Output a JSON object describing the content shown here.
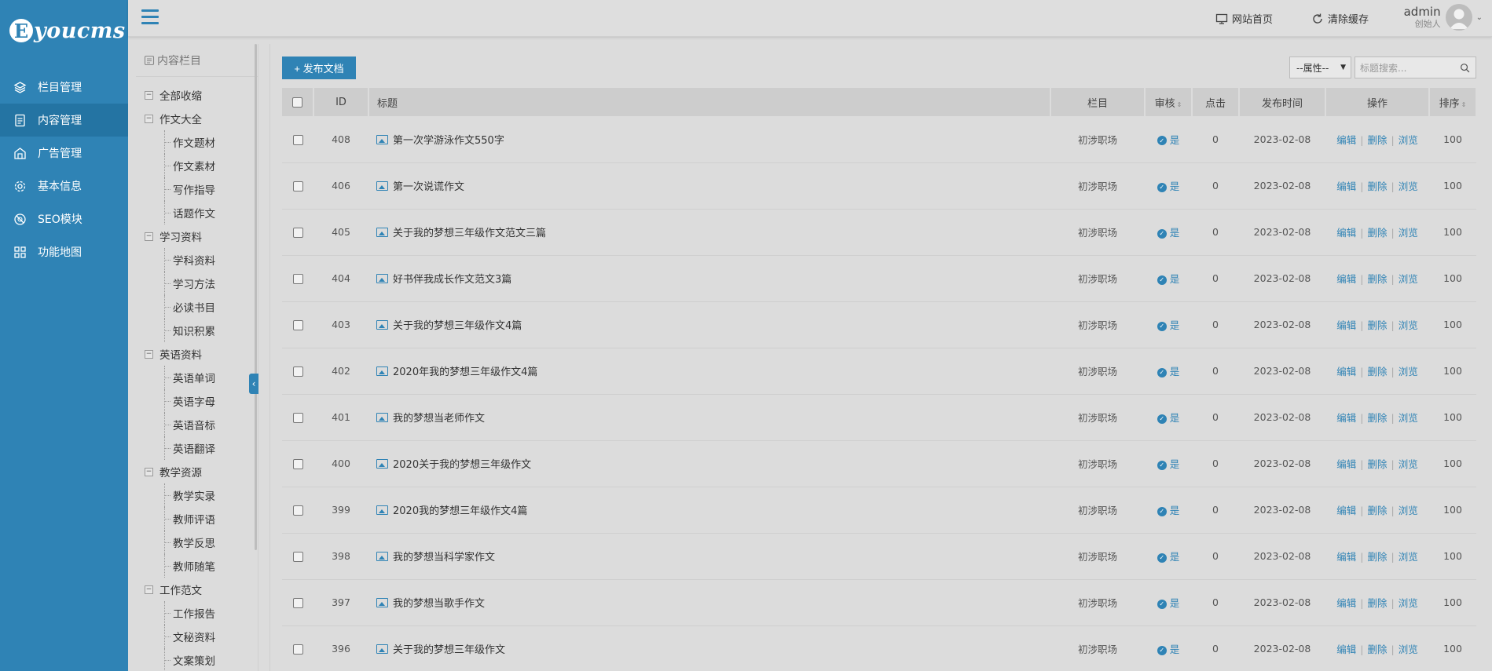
{
  "logo": {
    "mark": "E",
    "text": "youcms"
  },
  "sidebar": {
    "items": [
      {
        "label": "栏目管理",
        "icon": "layers-icon",
        "active": false
      },
      {
        "label": "内容管理",
        "icon": "document-icon",
        "active": true
      },
      {
        "label": "广告管理",
        "icon": "ad-icon",
        "active": false
      },
      {
        "label": "基本信息",
        "icon": "gear-icon",
        "active": false
      },
      {
        "label": "SEO模块",
        "icon": "seo-icon",
        "active": false
      },
      {
        "label": "功能地图",
        "icon": "grid-icon",
        "active": false
      }
    ]
  },
  "header": {
    "home_label": "网站首页",
    "clear_cache_label": "清除缓存",
    "user_name": "admin",
    "user_role": "创始人"
  },
  "tree": {
    "title": "内容栏目",
    "nodes": [
      {
        "label": "全部收缩",
        "level": 0
      },
      {
        "label": "作文大全",
        "level": 0
      },
      {
        "label": "作文题材",
        "level": 1
      },
      {
        "label": "作文素材",
        "level": 1
      },
      {
        "label": "写作指导",
        "level": 1
      },
      {
        "label": "话题作文",
        "level": 1
      },
      {
        "label": "学习资料",
        "level": 0
      },
      {
        "label": "学科资料",
        "level": 1
      },
      {
        "label": "学习方法",
        "level": 1
      },
      {
        "label": "必读书目",
        "level": 1
      },
      {
        "label": "知识积累",
        "level": 1
      },
      {
        "label": "英语资料",
        "level": 0
      },
      {
        "label": "英语单词",
        "level": 1
      },
      {
        "label": "英语字母",
        "level": 1
      },
      {
        "label": "英语音标",
        "level": 1
      },
      {
        "label": "英语翻译",
        "level": 1
      },
      {
        "label": "教学资源",
        "level": 0
      },
      {
        "label": "教学实录",
        "level": 1
      },
      {
        "label": "教师评语",
        "level": 1
      },
      {
        "label": "教学反思",
        "level": 1
      },
      {
        "label": "教师随笔",
        "level": 1
      },
      {
        "label": "工作范文",
        "level": 0
      },
      {
        "label": "工作报告",
        "level": 1
      },
      {
        "label": "文秘资料",
        "level": 1
      },
      {
        "label": "文案策划",
        "level": 1
      }
    ]
  },
  "toolbar": {
    "add_label": "+ 发布文档",
    "attr_select": "--属性--",
    "search_placeholder": "标题搜索..."
  },
  "table": {
    "headers": {
      "id": "ID",
      "title": "标题",
      "column": "栏目",
      "review": "审核",
      "clicks": "点击",
      "date": "发布时间",
      "ops": "操作",
      "sort": "排序"
    },
    "ops": {
      "edit": "编辑",
      "delete": "删除",
      "view": "浏览"
    },
    "rows": [
      {
        "id": "408",
        "title": "第一次学游泳作文550字",
        "column": "初涉职场",
        "review": "是",
        "clicks": "0",
        "date": "2023-02-08",
        "sort": "100"
      },
      {
        "id": "406",
        "title": "第一次说谎作文",
        "column": "初涉职场",
        "review": "是",
        "clicks": "0",
        "date": "2023-02-08",
        "sort": "100"
      },
      {
        "id": "405",
        "title": "关于我的梦想三年级作文范文三篇",
        "column": "初涉职场",
        "review": "是",
        "clicks": "0",
        "date": "2023-02-08",
        "sort": "100"
      },
      {
        "id": "404",
        "title": "好书伴我成长作文范文3篇",
        "column": "初涉职场",
        "review": "是",
        "clicks": "0",
        "date": "2023-02-08",
        "sort": "100"
      },
      {
        "id": "403",
        "title": "关于我的梦想三年级作文4篇",
        "column": "初涉职场",
        "review": "是",
        "clicks": "0",
        "date": "2023-02-08",
        "sort": "100"
      },
      {
        "id": "402",
        "title": "2020年我的梦想三年级作文4篇",
        "column": "初涉职场",
        "review": "是",
        "clicks": "0",
        "date": "2023-02-08",
        "sort": "100"
      },
      {
        "id": "401",
        "title": "我的梦想当老师作文",
        "column": "初涉职场",
        "review": "是",
        "clicks": "0",
        "date": "2023-02-08",
        "sort": "100"
      },
      {
        "id": "400",
        "title": "2020关于我的梦想三年级作文",
        "column": "初涉职场",
        "review": "是",
        "clicks": "0",
        "date": "2023-02-08",
        "sort": "100"
      },
      {
        "id": "399",
        "title": "2020我的梦想三年级作文4篇",
        "column": "初涉职场",
        "review": "是",
        "clicks": "0",
        "date": "2023-02-08",
        "sort": "100"
      },
      {
        "id": "398",
        "title": "我的梦想当科学家作文",
        "column": "初涉职场",
        "review": "是",
        "clicks": "0",
        "date": "2023-02-08",
        "sort": "100"
      },
      {
        "id": "397",
        "title": "我的梦想当歌手作文",
        "column": "初涉职场",
        "review": "是",
        "clicks": "0",
        "date": "2023-02-08",
        "sort": "100"
      },
      {
        "id": "396",
        "title": "关于我的梦想三年级作文",
        "column": "初涉职场",
        "review": "是",
        "clicks": "0",
        "date": "2023-02-08",
        "sort": "100"
      }
    ]
  }
}
